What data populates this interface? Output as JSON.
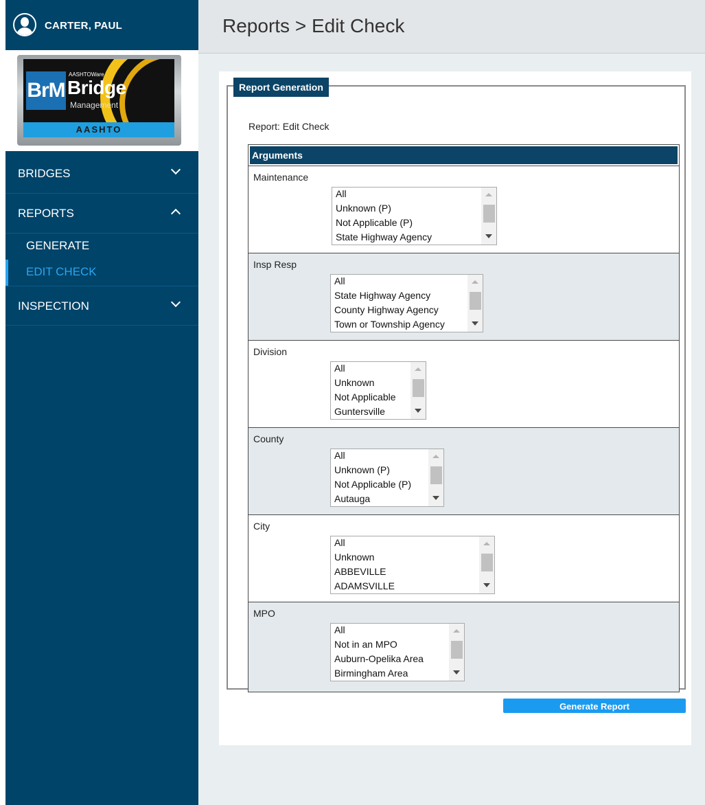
{
  "user": {
    "name": "CARTER, PAUL",
    "avatar_icon": "user-icon"
  },
  "logo": {
    "badge": "BrM",
    "small_text": "AASHTOWare",
    "title": "Bridge",
    "subtitle": "Management",
    "footer": "AASHTO"
  },
  "nav": {
    "bridges": {
      "label": "BRIDGES",
      "icon": "chevron-down-icon"
    },
    "reports": {
      "label": "REPORTS",
      "icon": "chevron-up-icon"
    },
    "generate": {
      "label": "GENERATE"
    },
    "edit_check": {
      "label": "EDIT CHECK"
    },
    "inspection": {
      "label": "INSPECTION",
      "icon": "chevron-down-icon"
    }
  },
  "header": {
    "title": "Reports > Edit Check"
  },
  "report": {
    "legend": "Report Generation",
    "report_label": "Report: Edit Check",
    "arguments_title": "Arguments",
    "arguments": [
      {
        "label": "Maintenance",
        "options": [
          "All",
          "Unknown (P)",
          "Not Applicable (P)",
          "State Highway Agency"
        ]
      },
      {
        "label": "Insp Resp",
        "options": [
          "All",
          "State Highway Agency",
          "County Highway Agency",
          "Town or Township Agency"
        ]
      },
      {
        "label": "Division",
        "options": [
          "All",
          "Unknown",
          "Not Applicable",
          "Guntersville"
        ]
      },
      {
        "label": "County",
        "options": [
          "All",
          "Unknown (P)",
          "Not Applicable (P)",
          "Autauga"
        ]
      },
      {
        "label": "City",
        "options": [
          "All",
          "Unknown",
          "ABBEVILLE",
          "ADAMSVILLE"
        ]
      },
      {
        "label": "MPO",
        "options": [
          "All",
          "Not in an MPO",
          "Auburn-Opelika Area",
          "Birmingham Area"
        ]
      }
    ],
    "generate_button": "Generate Report"
  }
}
